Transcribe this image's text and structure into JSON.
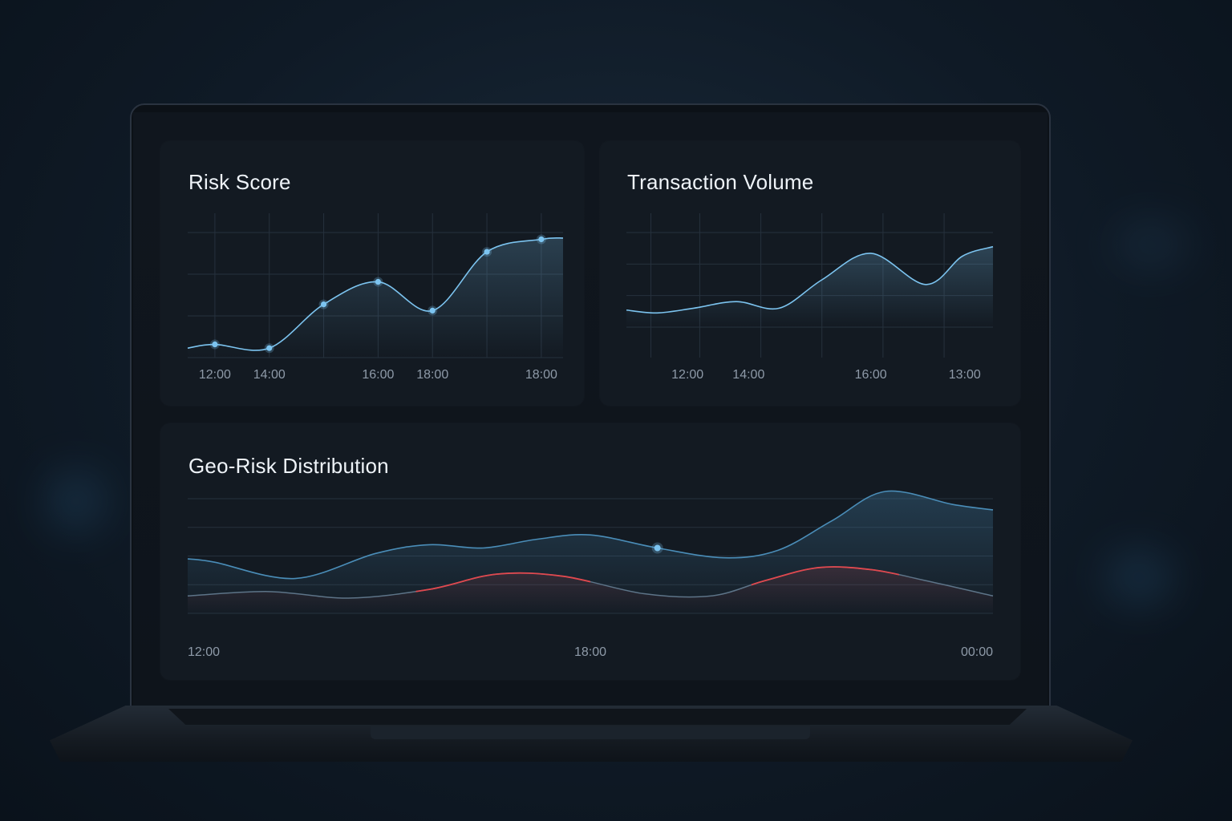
{
  "panels": {
    "risk_score": {
      "title": "Risk Score"
    },
    "transaction_volume": {
      "title": "Transaction Volume"
    },
    "geo_risk": {
      "title": "Geo-Risk Distribution"
    }
  },
  "colors": {
    "primary_line": "#7cc4f0",
    "secondary_line": "#4a8db8",
    "alert_line": "#e0484e",
    "grid": "#26313d",
    "tick_text": "#8e9aa8"
  },
  "chart_data": [
    {
      "id": "risk_score",
      "type": "line",
      "title": "Risk Score",
      "tick_labels": [
        "12:00",
        "14:00",
        "16:00",
        "18:00",
        "18:00"
      ],
      "tick_positions": [
        1,
        2,
        4,
        5,
        7
      ],
      "x": [
        0.5,
        1,
        2,
        3,
        4,
        5,
        6,
        7,
        7.4
      ],
      "y": [
        5,
        8,
        5,
        40,
        58,
        35,
        82,
        92,
        93
      ],
      "marked_points": [
        1,
        2,
        3,
        4,
        5,
        6,
        7
      ],
      "xlim": [
        0.5,
        7.4
      ],
      "ylim": [
        0,
        100
      ],
      "grid": true
    },
    {
      "id": "transaction_volume",
      "type": "area",
      "title": "Transaction Volume",
      "tick_labels": [
        "12:00",
        "14:00",
        "16:00",
        "13:00"
      ],
      "tick_positions": [
        1,
        2,
        4,
        5.8
      ],
      "x": [
        0,
        0.5,
        1.1,
        1.8,
        2.5,
        3.2,
        4.0,
        4.9,
        5.5,
        6.0
      ],
      "y": [
        18,
        15,
        20,
        27,
        20,
        50,
        78,
        45,
        75,
        85
      ],
      "xlim": [
        0,
        6.0
      ],
      "ylim": [
        0,
        100
      ],
      "grid": true
    },
    {
      "id": "geo_risk",
      "type": "area",
      "title": "Geo-Risk Distribution",
      "tick_labels": [
        "12:00",
        "18:00",
        "00:00"
      ],
      "tick_positions": [
        0,
        6,
        12
      ],
      "xlim": [
        0,
        12
      ],
      "ylim": [
        0,
        100
      ],
      "grid": true,
      "series": [
        {
          "x": [
            0,
            0.4,
            1.6,
            2.8,
            3.6,
            4.4,
            5.2,
            6.0,
            7.0,
            8.0,
            8.8,
            9.6,
            10.4,
            11.4,
            12.0
          ],
          "y": [
            50,
            47,
            32,
            55,
            63,
            60,
            68,
            72,
            60,
            51,
            58,
            85,
            112,
            100,
            95
          ],
          "marked_points": [
            8
          ]
        },
        {
          "x": [
            0,
            1.2,
            2.4,
            3.6,
            4.6,
            5.6,
            6.8,
            7.8,
            8.6,
            9.4,
            10.2,
            11.0,
            12.0
          ],
          "y": [
            16,
            20,
            14,
            22,
            36,
            34,
            18,
            16,
            30,
            42,
            40,
            30,
            16
          ],
          "alert_ranges": [
            [
              3.4,
              6.0
            ],
            [
              8.4,
              10.6
            ]
          ]
        }
      ]
    }
  ]
}
